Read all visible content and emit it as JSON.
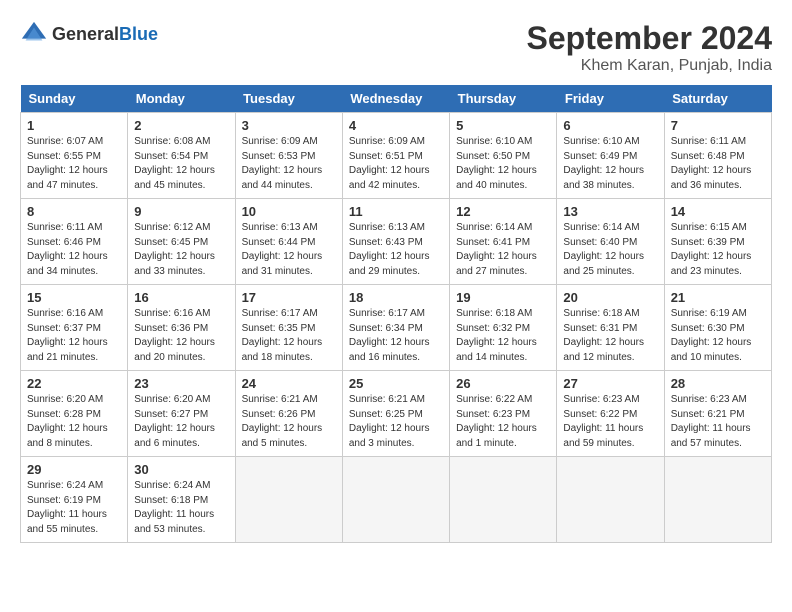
{
  "header": {
    "logo_general": "General",
    "logo_blue": "Blue",
    "month_year": "September 2024",
    "location": "Khem Karan, Punjab, India"
  },
  "days_of_week": [
    "Sunday",
    "Monday",
    "Tuesday",
    "Wednesday",
    "Thursday",
    "Friday",
    "Saturday"
  ],
  "weeks": [
    [
      {
        "day": "1",
        "info": "Sunrise: 6:07 AM\nSunset: 6:55 PM\nDaylight: 12 hours\nand 47 minutes."
      },
      {
        "day": "2",
        "info": "Sunrise: 6:08 AM\nSunset: 6:54 PM\nDaylight: 12 hours\nand 45 minutes."
      },
      {
        "day": "3",
        "info": "Sunrise: 6:09 AM\nSunset: 6:53 PM\nDaylight: 12 hours\nand 44 minutes."
      },
      {
        "day": "4",
        "info": "Sunrise: 6:09 AM\nSunset: 6:51 PM\nDaylight: 12 hours\nand 42 minutes."
      },
      {
        "day": "5",
        "info": "Sunrise: 6:10 AM\nSunset: 6:50 PM\nDaylight: 12 hours\nand 40 minutes."
      },
      {
        "day": "6",
        "info": "Sunrise: 6:10 AM\nSunset: 6:49 PM\nDaylight: 12 hours\nand 38 minutes."
      },
      {
        "day": "7",
        "info": "Sunrise: 6:11 AM\nSunset: 6:48 PM\nDaylight: 12 hours\nand 36 minutes."
      }
    ],
    [
      {
        "day": "8",
        "info": "Sunrise: 6:11 AM\nSunset: 6:46 PM\nDaylight: 12 hours\nand 34 minutes."
      },
      {
        "day": "9",
        "info": "Sunrise: 6:12 AM\nSunset: 6:45 PM\nDaylight: 12 hours\nand 33 minutes."
      },
      {
        "day": "10",
        "info": "Sunrise: 6:13 AM\nSunset: 6:44 PM\nDaylight: 12 hours\nand 31 minutes."
      },
      {
        "day": "11",
        "info": "Sunrise: 6:13 AM\nSunset: 6:43 PM\nDaylight: 12 hours\nand 29 minutes."
      },
      {
        "day": "12",
        "info": "Sunrise: 6:14 AM\nSunset: 6:41 PM\nDaylight: 12 hours\nand 27 minutes."
      },
      {
        "day": "13",
        "info": "Sunrise: 6:14 AM\nSunset: 6:40 PM\nDaylight: 12 hours\nand 25 minutes."
      },
      {
        "day": "14",
        "info": "Sunrise: 6:15 AM\nSunset: 6:39 PM\nDaylight: 12 hours\nand 23 minutes."
      }
    ],
    [
      {
        "day": "15",
        "info": "Sunrise: 6:16 AM\nSunset: 6:37 PM\nDaylight: 12 hours\nand 21 minutes."
      },
      {
        "day": "16",
        "info": "Sunrise: 6:16 AM\nSunset: 6:36 PM\nDaylight: 12 hours\nand 20 minutes."
      },
      {
        "day": "17",
        "info": "Sunrise: 6:17 AM\nSunset: 6:35 PM\nDaylight: 12 hours\nand 18 minutes."
      },
      {
        "day": "18",
        "info": "Sunrise: 6:17 AM\nSunset: 6:34 PM\nDaylight: 12 hours\nand 16 minutes."
      },
      {
        "day": "19",
        "info": "Sunrise: 6:18 AM\nSunset: 6:32 PM\nDaylight: 12 hours\nand 14 minutes."
      },
      {
        "day": "20",
        "info": "Sunrise: 6:18 AM\nSunset: 6:31 PM\nDaylight: 12 hours\nand 12 minutes."
      },
      {
        "day": "21",
        "info": "Sunrise: 6:19 AM\nSunset: 6:30 PM\nDaylight: 12 hours\nand 10 minutes."
      }
    ],
    [
      {
        "day": "22",
        "info": "Sunrise: 6:20 AM\nSunset: 6:28 PM\nDaylight: 12 hours\nand 8 minutes."
      },
      {
        "day": "23",
        "info": "Sunrise: 6:20 AM\nSunset: 6:27 PM\nDaylight: 12 hours\nand 6 minutes."
      },
      {
        "day": "24",
        "info": "Sunrise: 6:21 AM\nSunset: 6:26 PM\nDaylight: 12 hours\nand 5 minutes."
      },
      {
        "day": "25",
        "info": "Sunrise: 6:21 AM\nSunset: 6:25 PM\nDaylight: 12 hours\nand 3 minutes."
      },
      {
        "day": "26",
        "info": "Sunrise: 6:22 AM\nSunset: 6:23 PM\nDaylight: 12 hours\nand 1 minute."
      },
      {
        "day": "27",
        "info": "Sunrise: 6:23 AM\nSunset: 6:22 PM\nDaylight: 11 hours\nand 59 minutes."
      },
      {
        "day": "28",
        "info": "Sunrise: 6:23 AM\nSunset: 6:21 PM\nDaylight: 11 hours\nand 57 minutes."
      }
    ],
    [
      {
        "day": "29",
        "info": "Sunrise: 6:24 AM\nSunset: 6:19 PM\nDaylight: 11 hours\nand 55 minutes."
      },
      {
        "day": "30",
        "info": "Sunrise: 6:24 AM\nSunset: 6:18 PM\nDaylight: 11 hours\nand 53 minutes."
      },
      null,
      null,
      null,
      null,
      null
    ]
  ]
}
